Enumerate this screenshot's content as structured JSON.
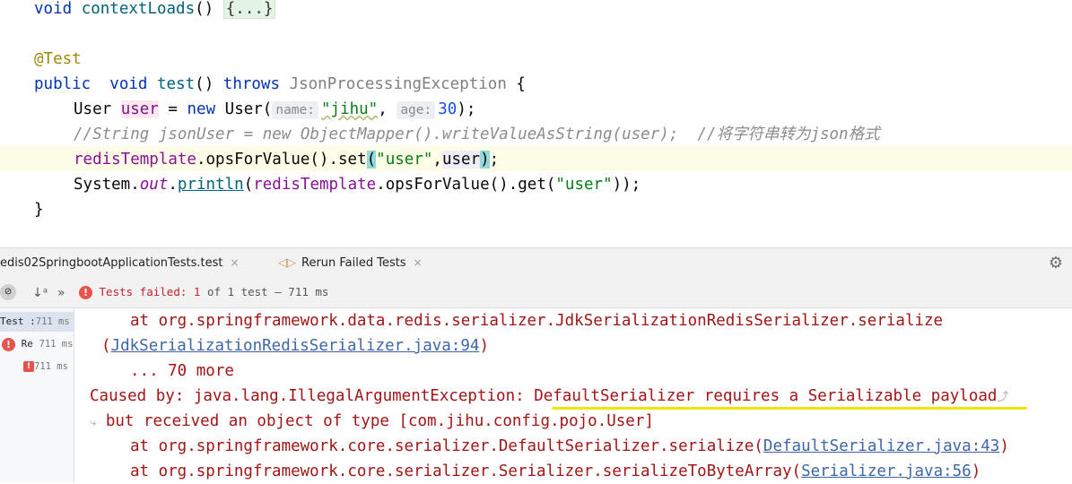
{
  "editor": {
    "line1": {
      "kw": "void",
      "fn": "contextLoads",
      "parens": "()",
      "fold": "{...}"
    },
    "line2": {
      "annotation": "@Test"
    },
    "line3": {
      "kw_public": "public",
      "kw_void": "void",
      "fn": "test",
      "parens": "()",
      "kw_throws": "throws",
      "exception": "JsonProcessingException",
      "brace": "{"
    },
    "line4": {
      "type": "User",
      "var": "user",
      "eq": "=",
      "kw_new": "new",
      "ctor": "User(",
      "hint_name": "name:",
      "str_arg": "\"jihu\"",
      "comma": ",",
      "hint_age": "age:",
      "num_arg": "30",
      "end": ");"
    },
    "line5": {
      "comment": "//String jsonUser = new ObjectMapper().writeValueAsString(user);  //将字符串转为json格式"
    },
    "line6": {
      "field": "redisTemplate",
      "call": ".opsForValue().set",
      "paren_open": "(",
      "str_arg": "\"user\"",
      "comma": ",",
      "arg": "user",
      "paren_close": ")",
      "semi": ";"
    },
    "line7": {
      "sys": "System.",
      "out": "out",
      "dot": ".",
      "println": "println",
      "paren_open": "(",
      "field": "redisTemplate",
      "call": ".opsForValue().get(",
      "str_arg": "\"user\"",
      "end": "));"
    },
    "line8": {
      "brace": "}"
    }
  },
  "run_window": {
    "tab_test": "edis02SpringbootApplicationTests.test",
    "tab_rerun": "Rerun Failed Tests",
    "close_glyph": "×",
    "status_failed": "Tests failed:",
    "status_count": "1",
    "status_of": "of 1 test",
    "status_dash": "–",
    "status_time": "711 ms",
    "tree": [
      {
        "label": "Test :",
        "time": "711 ms"
      },
      {
        "label": "Re",
        "time": "711 ms"
      },
      {
        "label": "",
        "time": "711 ms"
      }
    ]
  },
  "console": {
    "l1": "at org.springframework.data.redis.serializer.JdkSerializationRedisSerializer.serialize",
    "l2_link": "JdkSerializationRedisSerializer.java:94",
    "l3": "... 70 more",
    "l4_prefix": "Caused by: java.lang.IllegalArgumentException: ",
    "l4_msg": "DefaultSerializer requires a Serializable payload",
    "l5": "but received an object of type [com.jihu.config.pojo.User]",
    "l6": "at org.springframework.core.serializer.DefaultSerializer.serialize",
    "l6_link": "DefaultSerializer.java:43",
    "l7": "at org.springframework.core.serializer.Serializer.serializeToByteArray",
    "l7_link": "Serializer.java:56"
  },
  "colors": {
    "error": "#a31515",
    "keyword": "#0033b3",
    "string": "#067d17",
    "link": "#3e66a8",
    "underline": "#f2e600"
  }
}
